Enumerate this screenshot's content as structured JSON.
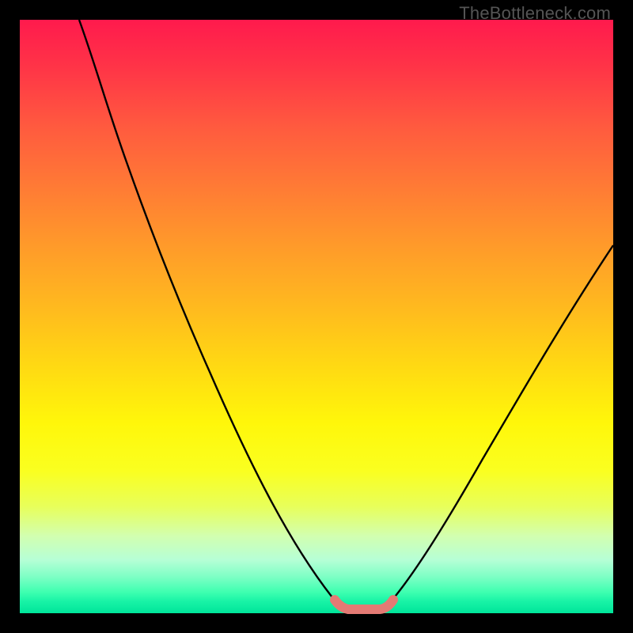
{
  "watermark": {
    "text": "TheBottleneck.com"
  },
  "colors": {
    "black": "#000000",
    "watermark": "#555555",
    "curve": "#000000",
    "highlight": "#e47a74"
  },
  "chart_data": {
    "type": "line",
    "title": "",
    "xlabel": "",
    "ylabel": "",
    "xlim": [
      0,
      100
    ],
    "ylim": [
      0,
      100
    ],
    "grid": false,
    "series": [
      {
        "name": "curve-left",
        "x": [
          10,
          12,
          15,
          18,
          22,
          26,
          30,
          34,
          38,
          42,
          46,
          50,
          52,
          54
        ],
        "values": [
          100,
          93,
          85,
          78,
          69,
          60,
          51,
          42,
          33,
          24,
          15,
          6,
          3,
          1
        ]
      },
      {
        "name": "curve-right",
        "x": [
          62,
          65,
          70,
          75,
          80,
          85,
          90,
          95,
          100
        ],
        "values": [
          1,
          3,
          9,
          17,
          26,
          35,
          44,
          53,
          62
        ]
      },
      {
        "name": "highlight-bottom",
        "x": [
          54,
          56,
          58,
          60,
          62
        ],
        "values": [
          1,
          0.4,
          0.3,
          0.4,
          1
        ]
      }
    ],
    "annotations": []
  }
}
